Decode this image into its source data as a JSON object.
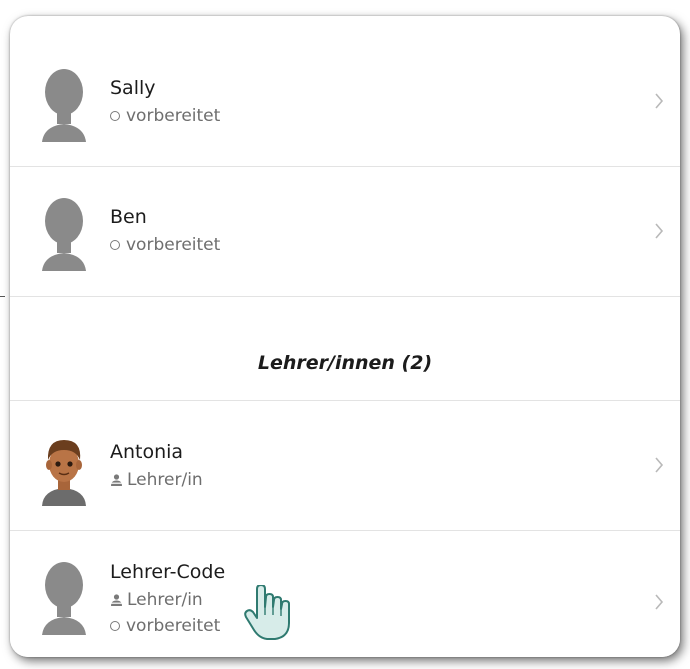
{
  "students": [
    {
      "name": "Sally",
      "status": "vorbereitet",
      "status_icon": "circle-icon",
      "avatar": "silhouette"
    },
    {
      "name": "Ben",
      "status": "vorbereitet",
      "status_icon": "circle-icon",
      "avatar": "silhouette"
    }
  ],
  "teachers_section": {
    "header": "Lehrer/innen (2)"
  },
  "teachers": [
    {
      "name": "Antonia",
      "role": "Lehrer/in",
      "role_icon": "person-icon",
      "avatar": "illustrated-person"
    },
    {
      "name": "Lehrer-Code",
      "role": "Lehrer/in",
      "role_icon": "person-icon",
      "status": "vorbereitet",
      "status_icon": "circle-icon",
      "avatar": "silhouette"
    }
  ],
  "colors": {
    "silhouette": "#8a8a8a",
    "text_primary": "#1c1c1c",
    "text_secondary": "#6e6e6e",
    "divider": "#e3e3e3",
    "chevron": "#b9b9b9",
    "cursor_fill": "#d7ece9",
    "cursor_stroke": "#2f7a70"
  },
  "cursor": {
    "icon": "hand-pointer-icon"
  }
}
